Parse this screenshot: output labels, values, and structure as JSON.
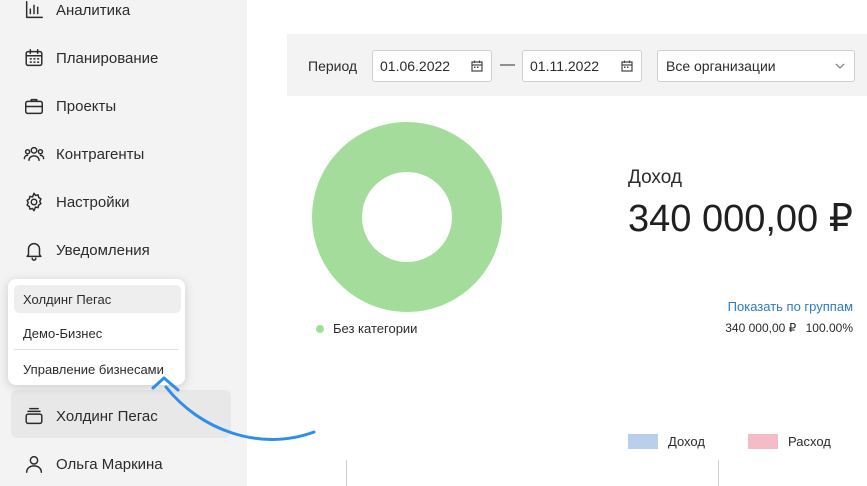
{
  "sidebar": {
    "items": [
      {
        "label": "Аналитика",
        "icon": "analytics-icon"
      },
      {
        "label": "Планирование",
        "icon": "calendar-icon"
      },
      {
        "label": "Проекты",
        "icon": "briefcase-icon"
      },
      {
        "label": "Контрагенты",
        "icon": "people-icon"
      },
      {
        "label": "Настройки",
        "icon": "gear-icon"
      },
      {
        "label": "Уведомления",
        "icon": "bell-icon"
      }
    ],
    "business": {
      "label": "Холдинг Пегас",
      "icon": "stack-icon"
    },
    "user": {
      "label": "Ольга Маркина",
      "icon": "user-icon"
    }
  },
  "popup": {
    "items": [
      "Холдинг Пегас",
      "Демо-Бизнес"
    ],
    "manage_label": "Управление бизнесами"
  },
  "filter": {
    "period_label": "Период",
    "date_from": "01.06.2022",
    "date_to": "01.11.2022",
    "dash": "—",
    "organization": "Все организации"
  },
  "income": {
    "title": "Доход",
    "value": "340 000,00 ₽",
    "show_groups_label": "Показать по группам",
    "group_amount": "340 000,00 ₽",
    "group_percent": "100.00%"
  },
  "pie": {
    "category": "Без категории",
    "color": "#a3dc9b"
  },
  "chart_legend": {
    "income": {
      "label": "Доход",
      "color": "#b9d0ec"
    },
    "expense": {
      "label": "Расход",
      "color": "#f4bcc6"
    }
  },
  "annotation": {
    "arrow_color": "#2f8ee8"
  }
}
